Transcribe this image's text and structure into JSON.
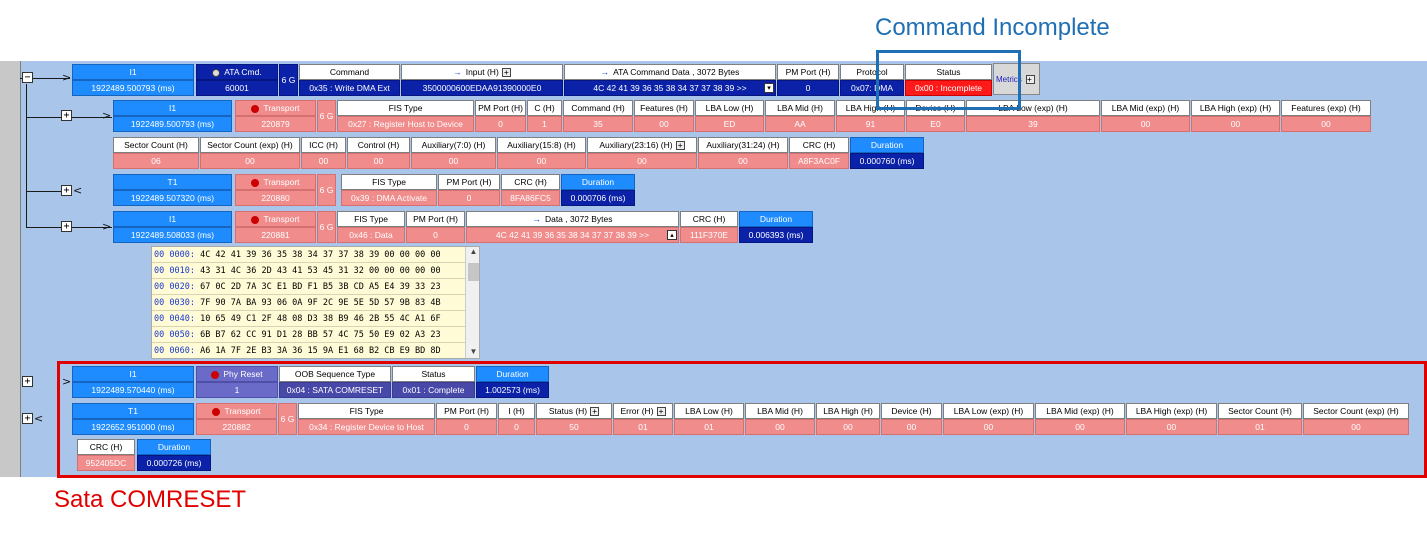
{
  "annotations": {
    "command_incomplete": "Command Incomplete",
    "sata_comreset": "Sata COMRESET"
  },
  "row1": {
    "dir": "I1",
    "time": "1922489.500793 (ms)",
    "kind": "ATA Cmd.",
    "kind_value": "60001",
    "speed": "6 G",
    "h_command": "Command",
    "command": "0x35 : Write DMA Ext",
    "h_input": "Input (H)",
    "input": "3500000600EDAA91390000E0",
    "h_data": "ATA Command Data , 3072 Bytes",
    "data": "4C 42 41 39 36 35 38 34 37 37 38 39  >>",
    "h_pm": "PM Port (H)",
    "pm": "0",
    "h_protocol": "Protocol",
    "protocol": "0x07: DMA",
    "h_status": "Status",
    "status": "0x00 : Incomplete",
    "metrics": "Metrics"
  },
  "row2": {
    "dir": "I1",
    "time": "1922489.500793 (ms)",
    "kind": "Transport",
    "kind_value": "220879",
    "speed": "6 G",
    "headers": [
      "FIS Type",
      "PM Port (H)",
      "C (H)",
      "Command (H)",
      "Features (H)",
      "LBA Low (H)",
      "LBA Mid (H)",
      "LBA High (H)",
      "Device (H)",
      "LBA Low (exp) (H)",
      "LBA Mid (exp) (H)",
      "LBA High (exp) (H)",
      "Features (exp) (H)"
    ],
    "values": [
      "0x27 : Register Host to Device",
      "0",
      "1",
      "35",
      "00",
      "ED",
      "AA",
      "91",
      "E0",
      "39",
      "00",
      "00",
      "00"
    ]
  },
  "row2b": {
    "headers": [
      "Sector Count (H)",
      "Sector Count (exp) (H)",
      "ICC (H)",
      "Control (H)",
      "Auxiliary(7:0) (H)",
      "Auxiliary(15:8) (H)",
      "Auxiliary(23:16) (H)",
      "Auxiliary(31:24) (H)",
      "CRC (H)",
      "Duration"
    ],
    "values": [
      "06",
      "00",
      "00",
      "00",
      "00",
      "00",
      "00",
      "00",
      "A8F3AC0F",
      "0.000760 (ms)"
    ]
  },
  "row3": {
    "dir": "T1",
    "time": "1922489.507320 (ms)",
    "kind": "Transport",
    "kind_value": "220880",
    "speed": "6 G",
    "headers": [
      "FIS Type",
      "PM Port (H)",
      "CRC (H)",
      "Duration"
    ],
    "values": [
      "0x39 : DMA Activate",
      "0",
      "8FA86FC5",
      "0.000706 (ms)"
    ]
  },
  "row4": {
    "dir": "I1",
    "time": "1922489.508033 (ms)",
    "kind": "Transport",
    "kind_value": "220881",
    "speed": "6 G",
    "headers": [
      "FIS Type",
      "PM Port (H)",
      "Data , 3072 Bytes",
      "CRC (H)",
      "Duration"
    ],
    "values": [
      "0x46 : Data",
      "0",
      "4C 42 41 39 36 35 38 34 37 37 38 39  >>",
      "111F370E",
      "0.006393 (ms)"
    ]
  },
  "hexdump": [
    {
      "off": "00 0000:",
      "bytes": " 4C 42 41 39 36 35 38 34 37 37 38 39 00 00 00 00"
    },
    {
      "off": "00 0010:",
      "bytes": " 43 31 4C 36 2D 43 41 53 45 31 32 00 00 00 00 00"
    },
    {
      "off": "00 0020:",
      "bytes": " 67 0C 2D 7A 3C E1 BD F1 B5 3B CD A5 E4 39 33 23"
    },
    {
      "off": "00 0030:",
      "bytes": " 7F 90 7A BA 93 06 0A 9F 2C 9E 5E 5D 57 9B 83 4B"
    },
    {
      "off": "00 0040:",
      "bytes": " 10 65 49 C1 2F 48 08 D3 38 B9 46 2B 55 4C A1 6F"
    },
    {
      "off": "00 0050:",
      "bytes": " 6B B7 62 CC 91 D1 28 BB 57 4C 75 50 E9 02 A3 23"
    },
    {
      "off": "00 0060:",
      "bytes": " A6 1A 7F 2E B3 3A 36 15 9A E1 68 B2 CB E9 BD 8D"
    }
  ],
  "row5": {
    "dir": "I1",
    "time": "1922489.570440 (ms)",
    "kind": "Phy Reset",
    "kind_value": "1",
    "headers": [
      "OOB Sequence Type",
      "Status",
      "Duration"
    ],
    "values": [
      "0x04 : SATA COMRESET",
      "0x01 : Complete",
      "1.002573 (ms)"
    ]
  },
  "row6": {
    "dir": "T1",
    "time": "1922652.951000 (ms)",
    "kind": "Transport",
    "kind_value": "220882",
    "speed": "6 G",
    "headers": [
      "FIS Type",
      "PM Port (H)",
      "I (H)",
      "Status (H)",
      "Error (H)",
      "LBA Low (H)",
      "LBA Mid (H)",
      "LBA High (H)",
      "Device (H)",
      "LBA Low (exp) (H)",
      "LBA Mid (exp) (H)",
      "LBA High (exp) (H)",
      "Sector Count (H)",
      "Sector Count (exp) (H)"
    ],
    "values": [
      "0x34 : Register Device to Host",
      "0",
      "0",
      "50",
      "01",
      "01",
      "00",
      "00",
      "00",
      "00",
      "00",
      "00",
      "01",
      "00"
    ]
  },
  "row6b": {
    "headers": [
      "CRC (H)",
      "Duration"
    ],
    "values": [
      "952405DC",
      "0.000726 (ms)"
    ]
  },
  "colors": {
    "panel": "#a9c5ea",
    "blue": "#1e8cff",
    "navy": "#0b22a8",
    "salmon": "#f08c8c",
    "purple": "#6a6ac8",
    "incomplete_red": "#ff1a1a",
    "annot_blue": "#1f6fb4",
    "annot_red": "#e00000"
  }
}
